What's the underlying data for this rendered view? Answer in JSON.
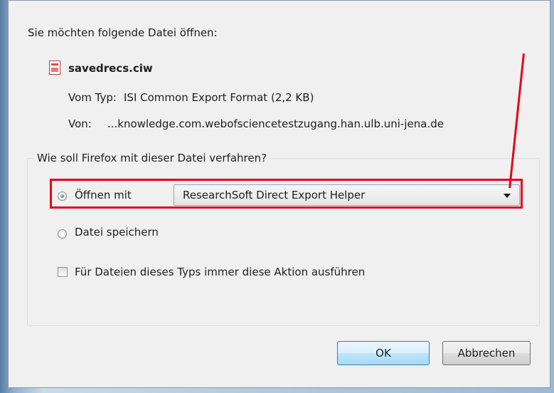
{
  "dialog": {
    "prompt": "Sie möchten folgende Datei öffnen:",
    "file": {
      "icon": "ciw-file-icon",
      "name": "savedrecs.ciw",
      "type_label": "Vom Typ:",
      "type_value": "ISI Common Export Format (2,2 KB)",
      "from_label": "Von:",
      "from_value": "...knowledge.com.webofsciencetestzugang.han.ulb.uni-jena.de"
    },
    "group": {
      "legend": "Wie soll Firefox mit dieser Datei verfahren?",
      "open_with": {
        "label": "Öffnen mit",
        "checked": true
      },
      "application": "ResearchSoft Direct Export Helper",
      "save": {
        "label": "Datei speichern",
        "checked": false
      },
      "always": {
        "label": "Für Dateien dieses Typs immer diese Aktion ausführen",
        "checked": false
      }
    },
    "buttons": {
      "ok": "OK",
      "cancel": "Abbrechen"
    },
    "highlight_color": "#e3061b"
  }
}
